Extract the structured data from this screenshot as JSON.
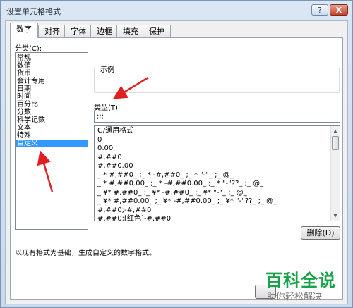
{
  "window": {
    "title": "设置单元格格式"
  },
  "titlebar_buttons": {
    "help": "?",
    "close": "X"
  },
  "tabs": [
    {
      "label": "数字",
      "active": true
    },
    {
      "label": "对齐"
    },
    {
      "label": "字体"
    },
    {
      "label": "边框"
    },
    {
      "label": "填充"
    },
    {
      "label": "保护"
    }
  ],
  "category": {
    "label": "分类(C):",
    "items": [
      "常规",
      "数值",
      "货币",
      "会计专用",
      "日期",
      "时间",
      "百分比",
      "分数",
      "科学记数",
      "文本",
      "特殊",
      "自定义"
    ],
    "selected": "自定义"
  },
  "sample": {
    "label": "示例"
  },
  "type": {
    "label": "类型(T):",
    "value": ";;;",
    "formats": [
      "G/通用格式",
      "0",
      "0.00",
      "#,##0",
      "#,##0.00",
      "_ * #,##0_ ;_ * -#,##0_ ;_ * \"-\"_ ;_ @_",
      "_ * #,##0.00_ ;_ * -#,##0.00_ ;_ * \"-\"??_ ;_ @_",
      "_ ¥* #,##0_ ;_ ¥* -#,##0_ ;_ ¥* \"-\"_ ;_ @_",
      "_ ¥* #,##0.00_ ;_ ¥* -#,##0.00_ ;_ ¥* \"-\"??_ ;_ @_",
      "#,##0;-#,##0",
      "#,##0;[红色]-#,##0"
    ]
  },
  "delete_button": {
    "label": "删除(D)"
  },
  "description": "以现有格式为基础，生成自定义的数字格式。",
  "watermark": {
    "main": "百科全说",
    "sub": "助你轻松解决"
  },
  "colors": {
    "selection": "#3399ff",
    "annotation_arrow": "#e02020",
    "watermark": "#17a34a"
  }
}
